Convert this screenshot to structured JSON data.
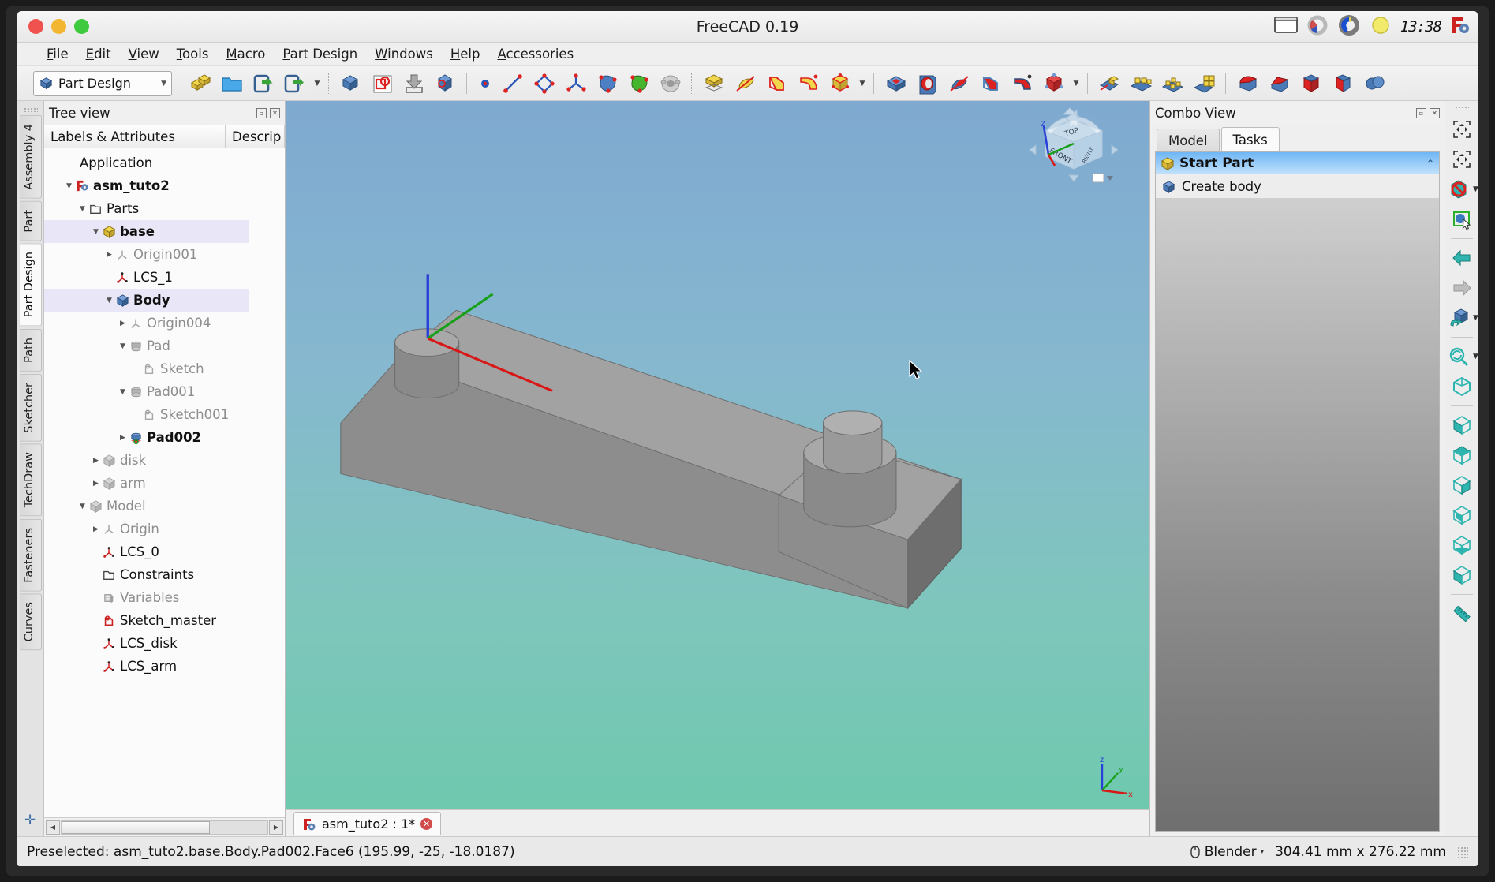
{
  "window": {
    "title": "FreeCAD 0.19",
    "clock": "13:38"
  },
  "menubar": {
    "items": [
      {
        "label": "File",
        "accel": "F"
      },
      {
        "label": "Edit",
        "accel": "E"
      },
      {
        "label": "View",
        "accel": "V"
      },
      {
        "label": "Tools",
        "accel": "T"
      },
      {
        "label": "Macro",
        "accel": "M"
      },
      {
        "label": "Part Design",
        "accel": "P"
      },
      {
        "label": "Windows",
        "accel": "W"
      },
      {
        "label": "Help",
        "accel": "H"
      },
      {
        "label": "Accessories",
        "accel": "A"
      }
    ]
  },
  "toolbar": {
    "workbench_selected": "Part Design",
    "buttons": [
      "new-document-icon",
      "open-document-icon",
      "save-document-icon",
      "save-as-document-icon",
      "refresh-icon",
      "cut-icon",
      "paste-icon",
      "std-boxelement-icon",
      "create-point-icon",
      "create-line-icon",
      "create-polyline-icon",
      "create-datum-icon",
      "shape-builder-icon",
      "shape-green-icon",
      "sheep-macro-icon",
      "pad-icon",
      "revolution-icon",
      "additive-loft-icon",
      "additive-pipe-icon",
      "additive-box-icon",
      "pocket-icon",
      "hole-icon",
      "groove-icon",
      "subtractive-loft-icon",
      "subtractive-pipe-icon",
      "subtractive-box-icon",
      "mirrored-icon",
      "linear-pattern-icon",
      "polar-pattern-icon",
      "multi-transform-icon",
      "fillet-icon",
      "chamfer-icon",
      "draft-icon",
      "thickness-icon",
      "boolean-icon"
    ]
  },
  "workbench_tabs": {
    "items": [
      {
        "label": "Assembly 4",
        "active": false
      },
      {
        "label": "Part",
        "active": false
      },
      {
        "label": "Part Design",
        "active": true
      },
      {
        "label": "Path",
        "active": false
      },
      {
        "label": "Sketcher",
        "active": false
      },
      {
        "label": "TechDraw",
        "active": false
      },
      {
        "label": "Fasteners",
        "active": false
      },
      {
        "label": "Curves",
        "active": false
      }
    ]
  },
  "tree": {
    "dock_title": "Tree view",
    "columns": [
      "Labels & Attributes",
      "Descrip"
    ],
    "rows": [
      {
        "label": "Application",
        "depth": 0,
        "arrow": "",
        "icon": "",
        "style": "dark",
        "selected": false
      },
      {
        "label": "asm_tuto2",
        "depth": 1,
        "arrow": "down",
        "icon": "document-icon",
        "style": "bold",
        "selected": false
      },
      {
        "label": "Parts",
        "depth": 2,
        "arrow": "down",
        "icon": "group-folder-icon",
        "style": "dark",
        "selected": false
      },
      {
        "label": "base",
        "depth": 3,
        "arrow": "down",
        "icon": "part-yellow-icon",
        "style": "bold",
        "selected": true
      },
      {
        "label": "Origin001",
        "depth": 4,
        "arrow": "right",
        "icon": "origin-grey-icon",
        "style": "grey",
        "selected": false
      },
      {
        "label": "LCS_1",
        "depth": 4,
        "arrow": "",
        "icon": "lcs-icon",
        "style": "dark",
        "selected": false
      },
      {
        "label": "Body",
        "depth": 4,
        "arrow": "down",
        "icon": "body-blue-icon",
        "style": "bold",
        "selected": true
      },
      {
        "label": "Origin004",
        "depth": 5,
        "arrow": "right",
        "icon": "origin-grey-icon",
        "style": "grey",
        "selected": false
      },
      {
        "label": "Pad",
        "depth": 5,
        "arrow": "down",
        "icon": "pad-grey-icon",
        "style": "grey",
        "selected": false
      },
      {
        "label": "Sketch",
        "depth": 6,
        "arrow": "",
        "icon": "sketch-grey-icon",
        "style": "grey",
        "selected": false
      },
      {
        "label": "Pad001",
        "depth": 5,
        "arrow": "down",
        "icon": "pad-grey-icon",
        "style": "grey",
        "selected": false
      },
      {
        "label": "Sketch001",
        "depth": 6,
        "arrow": "",
        "icon": "sketch-grey-icon",
        "style": "grey",
        "selected": false
      },
      {
        "label": "Pad002",
        "depth": 5,
        "arrow": "right",
        "icon": "pad-tip-icon",
        "style": "bold",
        "selected": false
      },
      {
        "label": "disk",
        "depth": 3,
        "arrow": "right",
        "icon": "part-grey-icon",
        "style": "grey",
        "selected": false
      },
      {
        "label": "arm",
        "depth": 3,
        "arrow": "right",
        "icon": "part-grey-icon",
        "style": "grey",
        "selected": false
      },
      {
        "label": "Model",
        "depth": 2,
        "arrow": "down",
        "icon": "part-grey-icon",
        "style": "grey",
        "selected": false
      },
      {
        "label": "Origin",
        "depth": 3,
        "arrow": "right",
        "icon": "origin-grey-icon",
        "style": "grey",
        "selected": false
      },
      {
        "label": "LCS_0",
        "depth": 3,
        "arrow": "",
        "icon": "lcs-icon",
        "style": "dark",
        "selected": false
      },
      {
        "label": "Constraints",
        "depth": 3,
        "arrow": "",
        "icon": "group-folder-icon",
        "style": "dark",
        "selected": false
      },
      {
        "label": "Variables",
        "depth": 3,
        "arrow": "",
        "icon": "variables-icon",
        "style": "grey",
        "selected": false
      },
      {
        "label": "Sketch_master",
        "depth": 3,
        "arrow": "",
        "icon": "sketch-red-icon",
        "style": "dark",
        "selected": false
      },
      {
        "label": "LCS_disk",
        "depth": 3,
        "arrow": "",
        "icon": "lcs-icon",
        "style": "dark",
        "selected": false
      },
      {
        "label": "LCS_arm",
        "depth": 3,
        "arrow": "",
        "icon": "lcs-icon",
        "style": "dark",
        "selected": false
      }
    ]
  },
  "mdi": {
    "tab_label": "asm_tuto2 : 1*"
  },
  "combo": {
    "dock_title": "Combo View",
    "tabs": [
      {
        "label": "Model",
        "active": false
      },
      {
        "label": "Tasks",
        "active": true
      }
    ],
    "task_group": "Start Part",
    "task_items": [
      {
        "label": "Create body",
        "icon": "body-blue-icon"
      }
    ]
  },
  "rightrail": {
    "buttons": [
      "fit-all-icon",
      "fit-selection-icon",
      "draw-style-icon",
      "selection-view-icon",
      "back-arrow-icon",
      "forward-arrow-icon",
      "axonometric-icon",
      "refresh-view-icon",
      "isometric-icon",
      "front-view-icon",
      "top-view-icon",
      "right-view-icon",
      "rear-view-icon",
      "bottom-view-icon",
      "left-view-icon",
      "measure-icon"
    ]
  },
  "statusbar": {
    "message": "Preselected: asm_tuto2.base.Body.Pad002.Face6 (195.99, -25, -18.0187)",
    "nav_style": "Blender",
    "dimensions": "304.41 mm x 276.22 mm"
  },
  "viewport": {
    "navcube_labels": [
      "TOP",
      "FRONT",
      "RIGHT"
    ],
    "axis_labels": [
      "x",
      "y",
      "z"
    ],
    "navcube_axis_labels": [
      "Z"
    ]
  },
  "colors": {
    "accent": "#6fb6f5",
    "selection": "#e8e6f7",
    "model_grey": "#8a8a8a",
    "bg_top": "#7fa9d0",
    "bg_bottom": "#6fc9ae"
  }
}
